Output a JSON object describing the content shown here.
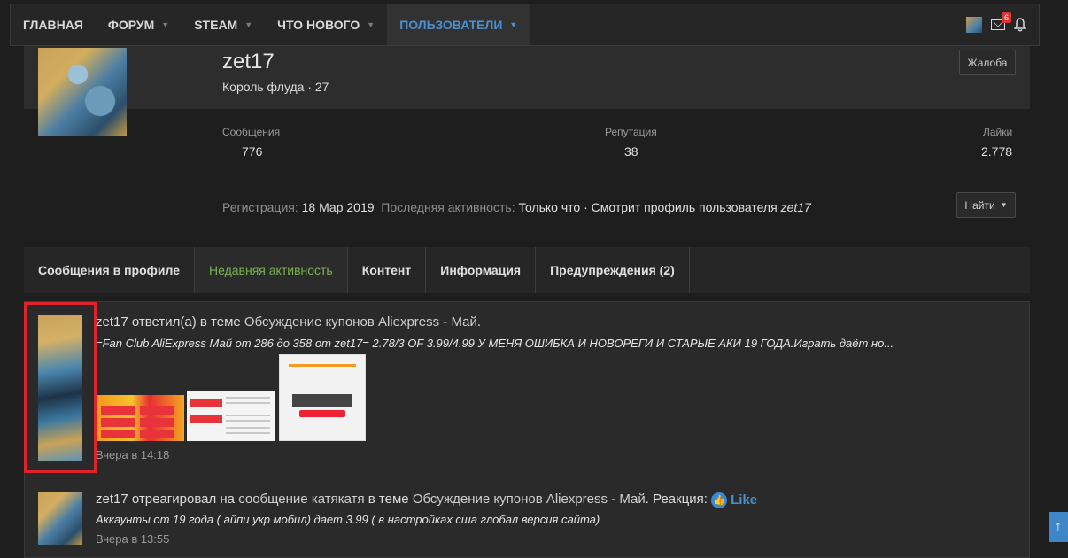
{
  "nav": {
    "items": [
      {
        "label": "Главная",
        "dropdown": false
      },
      {
        "label": "Форум",
        "dropdown": true
      },
      {
        "label": "Steam",
        "dropdown": true
      },
      {
        "label": "Что нового",
        "dropdown": true
      },
      {
        "label": "Пользователи",
        "dropdown": true,
        "active": true
      }
    ],
    "inbox_badge": "6"
  },
  "profile": {
    "username": "zet17",
    "title": "Король флуда · 27",
    "report_label": "Жалоба",
    "stats": [
      {
        "label": "Сообщения",
        "value": "776"
      },
      {
        "label": "Репутация",
        "value": "38"
      },
      {
        "label": "Лайки",
        "value": "2.778"
      }
    ],
    "registration_label": "Регистрация:",
    "registration_value": "18 Мар 2019",
    "last_activity_label": "Последняя активность:",
    "last_activity_value": "Только что · Смотрит профиль пользователя",
    "last_activity_user": "zet17",
    "find_label": "Найти"
  },
  "tabs": [
    {
      "label": "Сообщения в профиле"
    },
    {
      "label": "Недавняя активность",
      "active": true
    },
    {
      "label": "Контент"
    },
    {
      "label": "Информация"
    },
    {
      "label": "Предупреждения (2)"
    }
  ],
  "feed": [
    {
      "user": "zet17",
      "action": "ответил(а) в теме",
      "thread": "Обсуждение купонов Aliexpress - Май",
      "snippet": "=Fan Club AliExpress Май от 286 до 358 от zet17= 2.78/3 OF 3.99/4.99 У МЕНЯ ОШИБКА И НОВОРЕГИ И СТАРЫЕ АКИ 19 ГОДА.Играть даёт но...",
      "time": "Вчера в 14:18"
    },
    {
      "user": "zet17",
      "action": "отреагировал на",
      "target": "сообщение катякатя",
      "in_thread": "в теме",
      "thread": "Обсуждение купонов Aliexpress - Май",
      "reaction_label": "Реакция:",
      "reaction": "Like",
      "snippet": "Аккаунты от 19 года ( айпи укр мобил) дает 3.99 ( в настройках сша глобал версия сайта)",
      "time": "Вчера в 13:55"
    }
  ],
  "colors": {
    "accent": "#4a90d0",
    "active_tab": "#79b34f",
    "highlight": "#e0232b"
  }
}
